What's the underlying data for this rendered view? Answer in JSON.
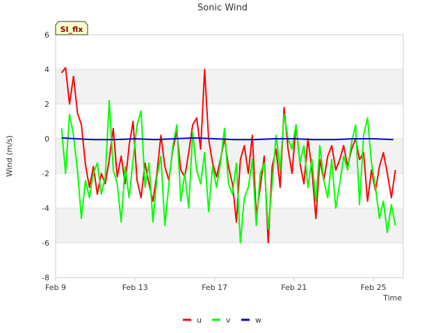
{
  "chart_data": {
    "type": "line",
    "title": "Sonic Wind",
    "xlabel": "Time",
    "ylabel": "Wind (m/s)",
    "ylim": [
      -8,
      6
    ],
    "yticks": [
      "-8",
      "-6",
      "-4",
      "-2",
      "0",
      "2",
      "4",
      "6"
    ],
    "xlim": [
      0,
      17.5
    ],
    "xticks": [
      {
        "label": "Feb 9",
        "x": 0
      },
      {
        "label": "Feb 13",
        "x": 4
      },
      {
        "label": "Feb 17",
        "x": 8
      },
      {
        "label": "Feb 21",
        "x": 12
      },
      {
        "label": "Feb 25",
        "x": 16
      }
    ],
    "grid": true,
    "legend_position": "bottom",
    "badge": "SI_flx",
    "series": [
      {
        "name": "u",
        "color": "#ff0000",
        "x": [
          0.3,
          0.5,
          0.7,
          0.9,
          1.1,
          1.3,
          1.5,
          1.7,
          1.9,
          2.1,
          2.3,
          2.5,
          2.7,
          2.9,
          3.1,
          3.3,
          3.5,
          3.7,
          3.9,
          4.1,
          4.3,
          4.5,
          4.7,
          4.9,
          5.1,
          5.3,
          5.5,
          5.7,
          5.9,
          6.1,
          6.3,
          6.5,
          6.7,
          6.9,
          7.1,
          7.3,
          7.5,
          7.7,
          7.9,
          8.1,
          8.3,
          8.5,
          8.7,
          8.9,
          9.1,
          9.3,
          9.5,
          9.7,
          9.9,
          10.1,
          10.3,
          10.5,
          10.7,
          10.9,
          11.1,
          11.3,
          11.5,
          11.7,
          11.9,
          12.1,
          12.3,
          12.5,
          12.7,
          12.9,
          13.1,
          13.3,
          13.5,
          13.7,
          13.9,
          14.1,
          14.3,
          14.5,
          14.7,
          14.9,
          15.1,
          15.3,
          15.5,
          15.7,
          15.9,
          16.1,
          16.3,
          16.5,
          16.7,
          16.9,
          17.1
        ],
        "values": [
          3.8,
          4.1,
          2.0,
          3.6,
          1.5,
          0.8,
          -1.5,
          -2.8,
          -1.6,
          -3.2,
          -2.0,
          -2.6,
          -1.2,
          0.6,
          -2.2,
          -1.0,
          -2.6,
          -0.4,
          1.0,
          -2.4,
          -3.4,
          -1.4,
          -2.6,
          -3.6,
          -2.0,
          0.2,
          -1.6,
          -2.4,
          -0.6,
          0.4,
          -1.8,
          -2.2,
          -0.8,
          0.8,
          1.2,
          -0.6,
          4.0,
          0.0,
          -1.4,
          -2.2,
          -1.2,
          0.0,
          -1.6,
          -2.6,
          -4.8,
          -1.2,
          -0.4,
          -2.0,
          0.2,
          -4.4,
          -2.8,
          -1.0,
          -6.0,
          -1.6,
          -0.6,
          -2.8,
          1.8,
          -0.6,
          -2.0,
          0.8,
          -1.4,
          -2.6,
          0.0,
          -1.8,
          -4.6,
          -1.2,
          -2.4,
          -1.0,
          -0.4,
          -1.8,
          -1.2,
          -0.4,
          -1.6,
          -0.6,
          0.0,
          -1.2,
          -0.8,
          -3.6,
          -1.8,
          -3.0,
          -1.6,
          -0.8,
          -2.0,
          -3.4,
          -1.8
        ]
      },
      {
        "name": "v",
        "color": "#00ff00",
        "x": [
          0.3,
          0.5,
          0.7,
          0.9,
          1.1,
          1.3,
          1.5,
          1.7,
          1.9,
          2.1,
          2.3,
          2.5,
          2.7,
          2.9,
          3.1,
          3.3,
          3.5,
          3.7,
          3.9,
          4.1,
          4.3,
          4.5,
          4.7,
          4.9,
          5.1,
          5.3,
          5.5,
          5.7,
          5.9,
          6.1,
          6.3,
          6.5,
          6.7,
          6.9,
          7.1,
          7.3,
          7.5,
          7.7,
          7.9,
          8.1,
          8.3,
          8.5,
          8.7,
          8.9,
          9.1,
          9.3,
          9.5,
          9.7,
          9.9,
          10.1,
          10.3,
          10.5,
          10.7,
          10.9,
          11.1,
          11.3,
          11.5,
          11.7,
          11.9,
          12.1,
          12.3,
          12.5,
          12.7,
          12.9,
          13.1,
          13.3,
          13.5,
          13.7,
          13.9,
          14.1,
          14.3,
          14.5,
          14.7,
          14.9,
          15.1,
          15.3,
          15.5,
          15.7,
          15.9,
          16.1,
          16.3,
          16.5,
          16.7,
          16.9,
          17.1
        ],
        "values": [
          0.6,
          -2.0,
          1.4,
          0.2,
          -1.8,
          -4.6,
          -2.4,
          -3.4,
          -2.0,
          -1.4,
          -3.2,
          -2.2,
          2.2,
          -1.8,
          -2.6,
          -4.8,
          -1.6,
          -3.4,
          -1.2,
          0.8,
          1.6,
          -2.8,
          -1.4,
          -4.8,
          -2.2,
          -1.0,
          -5.0,
          -2.6,
          -0.4,
          0.8,
          -3.6,
          -2.0,
          -4.0,
          0.4,
          -1.8,
          -2.6,
          -0.8,
          -4.2,
          -1.6,
          -2.8,
          -1.4,
          0.6,
          -2.6,
          -3.2,
          -1.4,
          -6.0,
          -3.4,
          -2.8,
          -1.2,
          -5.0,
          -2.0,
          -1.4,
          -5.2,
          -2.6,
          0.2,
          -1.8,
          1.4,
          0.0,
          -0.6,
          0.8,
          -1.4,
          -0.4,
          -2.8,
          -1.2,
          -3.6,
          -0.4,
          -2.4,
          -3.4,
          -1.2,
          -4.0,
          -2.6,
          -1.0,
          -1.8,
          -0.2,
          0.8,
          -3.8,
          0.2,
          1.2,
          -1.4,
          -2.8,
          -4.6,
          -3.6,
          -5.4,
          -3.8,
          -5.0
        ]
      },
      {
        "name": "w",
        "color": "#0000cc",
        "x": [
          0.3,
          1.0,
          2.0,
          3.0,
          4.0,
          5.0,
          6.0,
          7.0,
          8.0,
          9.0,
          10.0,
          11.0,
          12.0,
          13.0,
          14.0,
          15.0,
          16.0,
          17.0
        ],
        "values": [
          0.05,
          0.0,
          -0.05,
          -0.05,
          0.0,
          -0.05,
          0.0,
          0.05,
          0.0,
          -0.05,
          -0.05,
          0.0,
          0.0,
          -0.05,
          -0.05,
          0.0,
          0.0,
          -0.05
        ]
      }
    ]
  }
}
